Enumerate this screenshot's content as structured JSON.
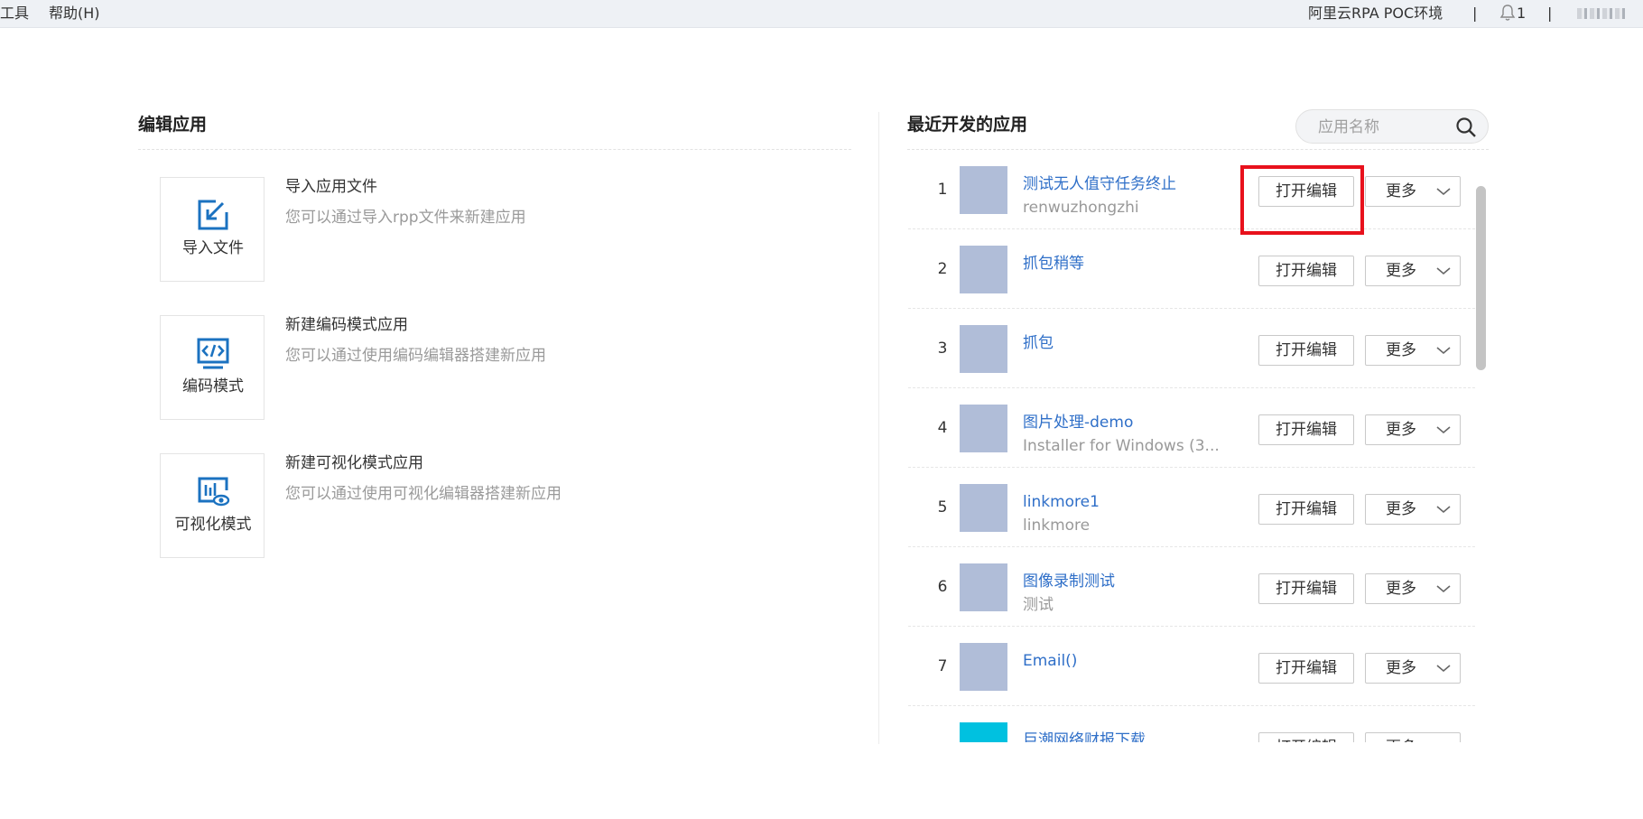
{
  "menu": {
    "tools": "工具",
    "help": "帮助(H)"
  },
  "header": {
    "environment": "阿里云RPA POC环境",
    "separator": "|",
    "notification_count": "1"
  },
  "edit_app": {
    "title": "编辑应用",
    "options": [
      {
        "card_label": "导入文件",
        "title": "导入应用文件",
        "description": "您可以通过导入rpp文件来新建应用",
        "icon": "import-icon"
      },
      {
        "card_label": "编码模式",
        "title": "新建编码模式应用",
        "description": "您可以通过使用编码编辑器搭建新应用",
        "icon": "code-icon"
      },
      {
        "card_label": "可视化模式",
        "title": "新建可视化模式应用",
        "description": "您可以通过使用可视化编辑器搭建新应用",
        "icon": "visual-chart-icon"
      }
    ]
  },
  "recent": {
    "title": "最近开发的应用",
    "search_placeholder": "应用名称",
    "open_label": "打开编辑",
    "more_label": "更多",
    "items": [
      {
        "index": "1",
        "name": "测试无人值守任务终止",
        "subtitle": "renwuzhongzhi"
      },
      {
        "index": "2",
        "name": "抓包稍等",
        "subtitle": ""
      },
      {
        "index": "3",
        "name": "抓包",
        "subtitle": ""
      },
      {
        "index": "4",
        "name": "图片处理-demo",
        "subtitle": "Installer for Windows (3..."
      },
      {
        "index": "5",
        "name": "linkmore1",
        "subtitle": "linkmore"
      },
      {
        "index": "6",
        "name": "图像录制测试",
        "subtitle": "测试"
      },
      {
        "index": "7",
        "name": "Email()",
        "subtitle": ""
      },
      {
        "index": "",
        "name": "巨潮网络财报下载",
        "subtitle": ""
      }
    ]
  },
  "colors": {
    "accent": "#2f6fc8",
    "thumb": "#b0bdd8",
    "highlight": "#e8111c",
    "icon_blue": "#1b72c0"
  }
}
